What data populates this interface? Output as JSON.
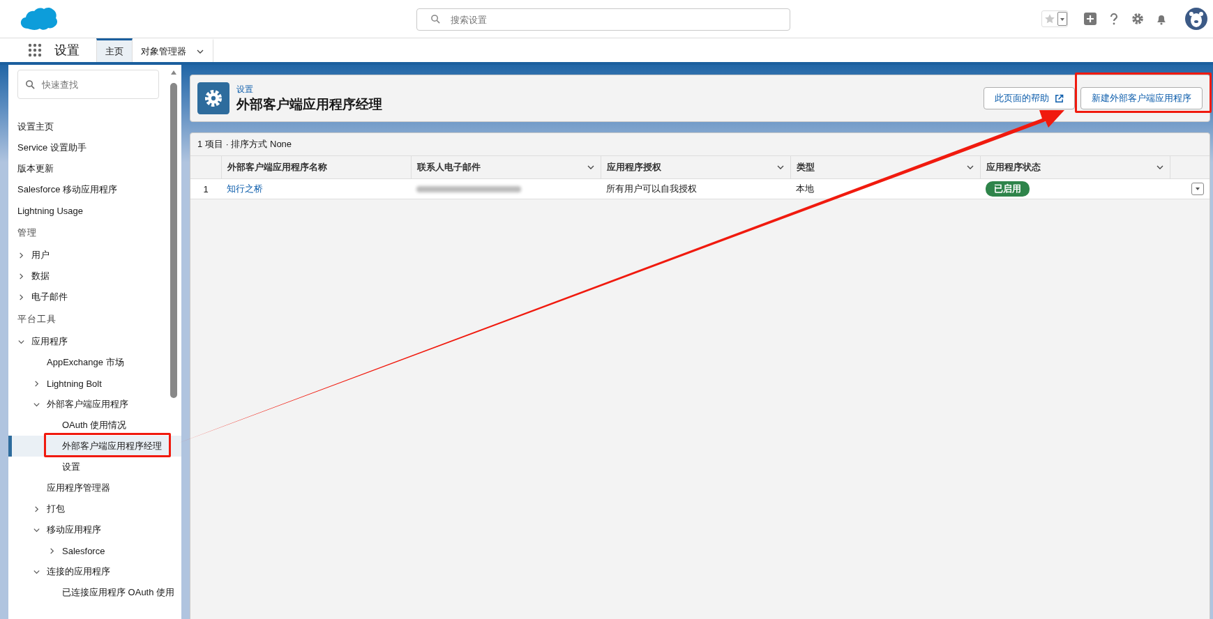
{
  "header": {
    "search": {
      "placeholder": "搜索设置"
    }
  },
  "nav": {
    "app_name": "设置",
    "tabs": [
      {
        "label": "主页",
        "selected": true,
        "has_menu": false
      },
      {
        "label": "对象管理器",
        "selected": false,
        "has_menu": true
      }
    ]
  },
  "sidebar": {
    "search": {
      "placeholder": "快速查找"
    },
    "sections": [
      {
        "items": [
          {
            "label": "设置主页",
            "kind": "link",
            "selected": false
          },
          {
            "label": "Service 设置助手",
            "kind": "link",
            "selected": false
          },
          {
            "label": "版本更新",
            "kind": "link",
            "selected": false
          },
          {
            "label": "Salesforce 移动应用程序",
            "kind": "link",
            "selected": false
          },
          {
            "label": "Lightning Usage",
            "kind": "link",
            "selected": false
          }
        ]
      },
      {
        "heading": "管理",
        "items": [
          {
            "label": "用户",
            "kind": "folder",
            "expanded": false,
            "selected": false
          },
          {
            "label": "数据",
            "kind": "folder",
            "expanded": false,
            "selected": false
          },
          {
            "label": "电子邮件",
            "kind": "folder",
            "expanded": false,
            "selected": false
          }
        ]
      },
      {
        "heading": "平台工具",
        "items": [
          {
            "label": "应用程序",
            "kind": "folder",
            "expanded": true,
            "selected": false,
            "children": [
              {
                "label": "AppExchange 市场",
                "kind": "leaf",
                "selected": false
              },
              {
                "label": "Lightning Bolt",
                "kind": "folder",
                "expanded": false,
                "selected": false
              },
              {
                "label": "外部客户端应用程序",
                "kind": "folder",
                "expanded": true,
                "selected": false,
                "children": [
                  {
                    "label": "OAuth 使用情况",
                    "kind": "leaf",
                    "selected": false
                  },
                  {
                    "label": "外部客户端应用程序经理",
                    "kind": "leaf",
                    "selected": true
                  },
                  {
                    "label": "设置",
                    "kind": "leaf",
                    "selected": false
                  }
                ]
              },
              {
                "label": "应用程序管理器",
                "kind": "leaf",
                "selected": false
              },
              {
                "label": "打包",
                "kind": "folder",
                "expanded": false,
                "selected": false
              },
              {
                "label": "移动应用程序",
                "kind": "folder",
                "expanded": true,
                "selected": false,
                "children": [
                  {
                    "label": "Salesforce",
                    "kind": "folder",
                    "expanded": false,
                    "selected": false
                  }
                ]
              },
              {
                "label": "连接的应用程序",
                "kind": "folder",
                "expanded": true,
                "selected": false,
                "children": [
                  {
                    "label": "已连接应用程序 OAuth 使用",
                    "kind": "leaf",
                    "selected": false
                  }
                ]
              }
            ]
          }
        ]
      }
    ]
  },
  "page_header": {
    "breadcrumb": "设置",
    "title": "外部客户端应用程序经理",
    "buttons": [
      {
        "label": "此页面的帮助",
        "external": true
      },
      {
        "label": "新建外部客户端应用程序",
        "external": false
      }
    ]
  },
  "table": {
    "summary": "1 项目 · 排序方式 None",
    "columns": [
      {
        "label": "外部客户端应用程序名称",
        "sortable": false
      },
      {
        "label": "联系人电子邮件",
        "sortable": true
      },
      {
        "label": "应用程序授权",
        "sortable": true
      },
      {
        "label": "类型",
        "sortable": true
      },
      {
        "label": "应用程序状态",
        "sortable": true
      }
    ],
    "rows": [
      {
        "index": "1",
        "name": "知行之桥",
        "email_redacted": true,
        "authorization": "所有用户可以自我授权",
        "type": "本地",
        "status": "已启用"
      }
    ]
  }
}
